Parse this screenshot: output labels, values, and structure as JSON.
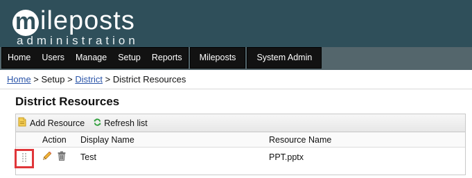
{
  "logo": {
    "letter": "m",
    "word": "ileposts",
    "subtitle": "administration"
  },
  "nav": {
    "main_items": [
      {
        "label": "Home"
      },
      {
        "label": "Users"
      },
      {
        "label": "Manage"
      },
      {
        "label": "Setup"
      },
      {
        "label": "Reports"
      }
    ],
    "mileposts_label": "Mileposts",
    "system_admin_label": "System Admin"
  },
  "breadcrumb": {
    "home": "Home",
    "sep1": " > ",
    "setup": "Setup",
    "sep2": " > ",
    "district": "District",
    "sep3": " > ",
    "current": "District Resources"
  },
  "page": {
    "title": "District Resources"
  },
  "toolbar": {
    "add_label": "Add Resource",
    "refresh_label": "Refresh list"
  },
  "table": {
    "headers": {
      "action": "Action",
      "display_name": "Display Name",
      "resource_name": "Resource Name"
    },
    "rows": [
      {
        "display_name": "Test",
        "resource_name": "PPT.pptx"
      }
    ]
  },
  "colors": {
    "header_bg": "#2f4f5a",
    "header_band": "#54666c",
    "nav_bg": "#121212",
    "link": "#2a54a8",
    "highlight": "#e0363a"
  },
  "icons": {
    "add": "document-add-icon",
    "refresh": "refresh-icon",
    "drag": "drag-handle-icon",
    "edit": "pencil-icon",
    "delete": "trash-icon"
  }
}
